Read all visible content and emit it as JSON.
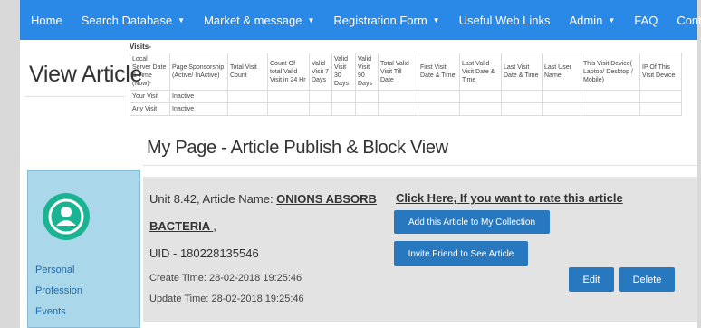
{
  "nav": {
    "home": "Home",
    "search_database": "Search Database",
    "market_message": "Market & message",
    "registration_form": "Registration Form",
    "useful_web_links": "Useful Web Links",
    "admin": "Admin",
    "faq": "FAQ",
    "contact_us": "Contact Us"
  },
  "page_title": "View Article",
  "visits": {
    "label": "Visits-",
    "headers": [
      "Local Server Date & Time (Now)-",
      "Page Sponsorship (Active/ InActive)",
      "Total Visit Count",
      "Count Of total Valid Visit in 24 Hr",
      "Valid Visit 7 Days",
      "Valid Visit 30 Days",
      "Valid Visit 90 Days",
      "Total Valid Visit Till Date",
      "First Visit Date & Time",
      "Last Valid Visit Date & Time",
      "Last Visit Date & Time",
      "Last User Name",
      "This Visit Device( Laptop/ Desktop / Mobile)",
      "IP Of This Visit Device"
    ],
    "rows": [
      [
        "Your Visit",
        "Inactive",
        "",
        "",
        "",
        "",
        "",
        "",
        "",
        "",
        "",
        "",
        "",
        ""
      ],
      [
        "Any Visit",
        "Inactive",
        "",
        "",
        "",
        "",
        "",
        "",
        "",
        "",
        "",
        "",
        "",
        ""
      ]
    ]
  },
  "page_heading": "My Page - Article Publish & Block View",
  "sidebar": {
    "avatar_icon": "user-avatar-icon",
    "links": [
      "Personal",
      "Profession",
      "Events"
    ]
  },
  "article": {
    "unit_prefix": "Unit 8.42, Article Name: ",
    "name_part1": "ONIONS ABSORB",
    "name_part2": "BACTERIA ",
    "name_suffix": ",",
    "uid": "UID - 180228135546",
    "create_time": "Create Time: 28-02-2018 19:25:46",
    "update_time": "Update Time: 28-02-2018 19:25:46"
  },
  "actions": {
    "rate_link": "Click Here, If you want to rate this article",
    "add_collection": "Add this Article to My Collection",
    "invite_friend": "Invite Friend to See Article",
    "edit": "Edit",
    "delete": "Delete"
  },
  "colors": {
    "navbar": "#2a88e6",
    "button": "#2878c0",
    "avatar": "#1bb492",
    "sidebar": "#abd7ea",
    "panel": "#e3e3e3"
  }
}
